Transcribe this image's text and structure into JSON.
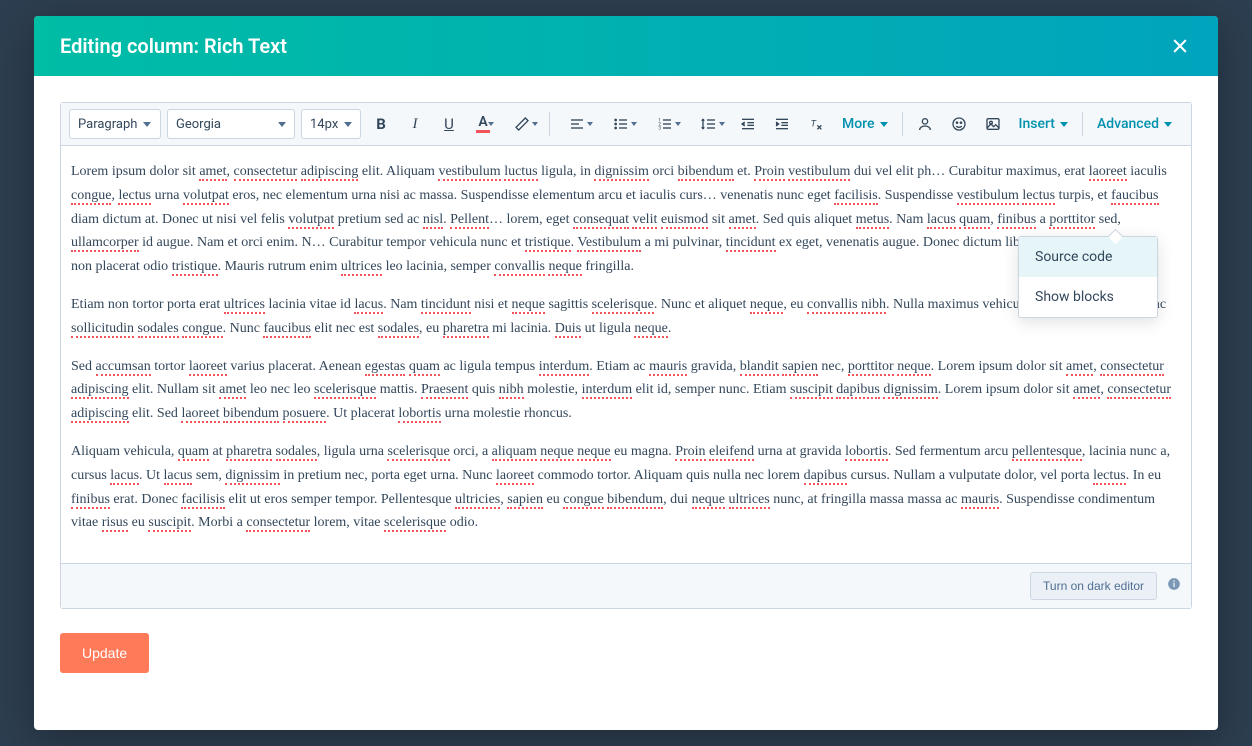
{
  "modal": {
    "title": "Editing column: Rich Text"
  },
  "toolbar": {
    "block_format": "Paragraph",
    "font_family": "Georgia",
    "font_size": "14px",
    "more_label": "More",
    "insert_label": "Insert",
    "advanced_label": "Advanced"
  },
  "advanced_menu": {
    "items": [
      "Source code",
      "Show blocks"
    ]
  },
  "editor": {
    "paragraphs": [
      "Lorem ipsum dolor sit amet, consectetur adipiscing elit. Aliquam vestibulum luctus ligula, in dignissim orci bibendum et. Proin vestibulum dui vel elit ph… Curabitur maximus, erat laoreet iaculis congue, lectus urna volutpat eros, nec elementum urna nisi ac massa. Suspendisse elementum arcu et iaculis curs… venenatis nunc eget facilisis. Suspendisse vestibulum lectus turpis, et faucibus diam dictum at. Donec ut nisi vel felis volutpat pretium sed ac nisl. Pellent… lorem, eget consequat velit euismod sit amet. Sed quis aliquet metus. Nam lacus quam, finibus a porttitor sed, ullamcorper id augue. Nam et orci enim. N… Curabitur tempor vehicula nunc et tristique. Vestibulum a mi pulvinar, tincidunt ex eget, venenatis augue. Donec dictum libero vitae est scelerisque, non placerat odio tristique. Mauris rutrum enim ultrices leo lacinia, semper convallis neque fringilla.",
      "Etiam non tortor porta erat ultrices lacinia vitae id lacus. Nam tincidunt nisi et neque sagittis scelerisque. Nunc et aliquet neque, eu convallis nibh. Nulla maximus vehicula nunc vel efficitur. Nunc sollicitudin sodales congue. Nunc faucibus elit nec est sodales, eu pharetra mi lacinia. Duis ut ligula neque.",
      "Sed accumsan tortor laoreet varius placerat. Aenean egestas quam ac ligula tempus interdum. Etiam ac mauris gravida, blandit sapien nec, porttitor neque. Lorem ipsum dolor sit amet, consectetur adipiscing elit. Nullam sit amet leo nec leo scelerisque mattis. Praesent quis nibh molestie, interdum elit id, semper nunc. Etiam suscipit dapibus dignissim. Lorem ipsum dolor sit amet, consectetur adipiscing elit. Sed laoreet bibendum posuere. Ut placerat lobortis urna molestie rhoncus.",
      "Aliquam vehicula, quam at pharetra sodales, ligula urna scelerisque orci, a aliquam neque neque eu magna. Proin eleifend urna at gravida lobortis. Sed fermentum arcu pellentesque, lacinia nunc a, cursus lacus. Ut lacus sem, dignissim in pretium nec, porta eget urna. Nunc laoreet commodo tortor. Aliquam quis nulla nec lorem dapibus cursus. Nullam a vulputate dolor, vel porta lectus. In eu finibus erat. Donec facilisis elit ut eros semper tempor. Pellentesque ultricies, sapien eu congue bibendum, dui neque ultrices nunc, at fringilla massa massa ac mauris. Suspendisse condimentum vitae risus eu suscipit. Morbi a consectetur lorem, vitae scelerisque odio."
    ]
  },
  "footer": {
    "dark_editor_label": "Turn on dark editor"
  },
  "actions": {
    "update_label": "Update"
  }
}
